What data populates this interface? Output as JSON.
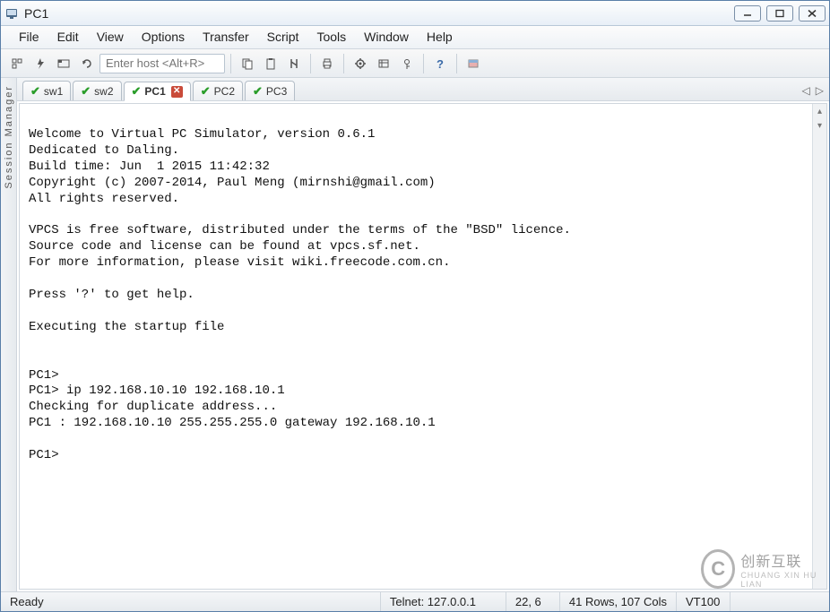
{
  "window": {
    "title": "PC1"
  },
  "menu": [
    "File",
    "Edit",
    "View",
    "Options",
    "Transfer",
    "Script",
    "Tools",
    "Window",
    "Help"
  ],
  "toolbar": {
    "host_placeholder": "Enter host <Alt+R>"
  },
  "session_manager_label": "Session Manager",
  "tabs": [
    {
      "label": "sw1",
      "active": false,
      "closable": false
    },
    {
      "label": "sw2",
      "active": false,
      "closable": false
    },
    {
      "label": "PC1",
      "active": true,
      "closable": true
    },
    {
      "label": "PC2",
      "active": false,
      "closable": false
    },
    {
      "label": "PC3",
      "active": false,
      "closable": false
    }
  ],
  "terminal_lines": [
    "",
    "Welcome to Virtual PC Simulator, version 0.6.1",
    "Dedicated to Daling.",
    "Build time: Jun  1 2015 11:42:32",
    "Copyright (c) 2007-2014, Paul Meng (mirnshi@gmail.com)",
    "All rights reserved.",
    "",
    "VPCS is free software, distributed under the terms of the \"BSD\" licence.",
    "Source code and license can be found at vpcs.sf.net.",
    "For more information, please visit wiki.freecode.com.cn.",
    "",
    "Press '?' to get help.",
    "",
    "Executing the startup file",
    "",
    "",
    "PC1>",
    "PC1> ip 192.168.10.10 192.168.10.1",
    "Checking for duplicate address...",
    "PC1 : 192.168.10.10 255.255.255.0 gateway 192.168.10.1",
    "",
    "PC1>"
  ],
  "status": {
    "ready": "Ready",
    "conn": "Telnet: 127.0.0.1",
    "cursor": "22,   6",
    "size": "41 Rows, 107 Cols",
    "term": "VT100"
  },
  "watermark": {
    "brand": "创新互联",
    "sub": "CHUANG XIN HU LIAN"
  }
}
